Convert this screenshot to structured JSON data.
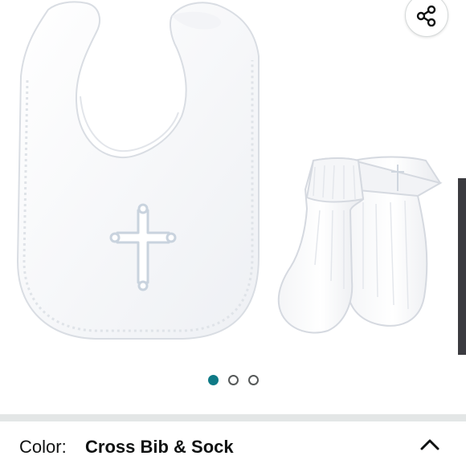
{
  "gallery": {
    "dots": [
      {
        "state": "active"
      },
      {
        "state": "inactive"
      },
      {
        "state": "inactive"
      }
    ],
    "accent_color": "#0f7a86"
  },
  "icons": {
    "share": "share-icon",
    "collapse": "chevron-up-icon"
  },
  "variation": {
    "label": "Color:",
    "value": "Cross Bib & Sock"
  }
}
